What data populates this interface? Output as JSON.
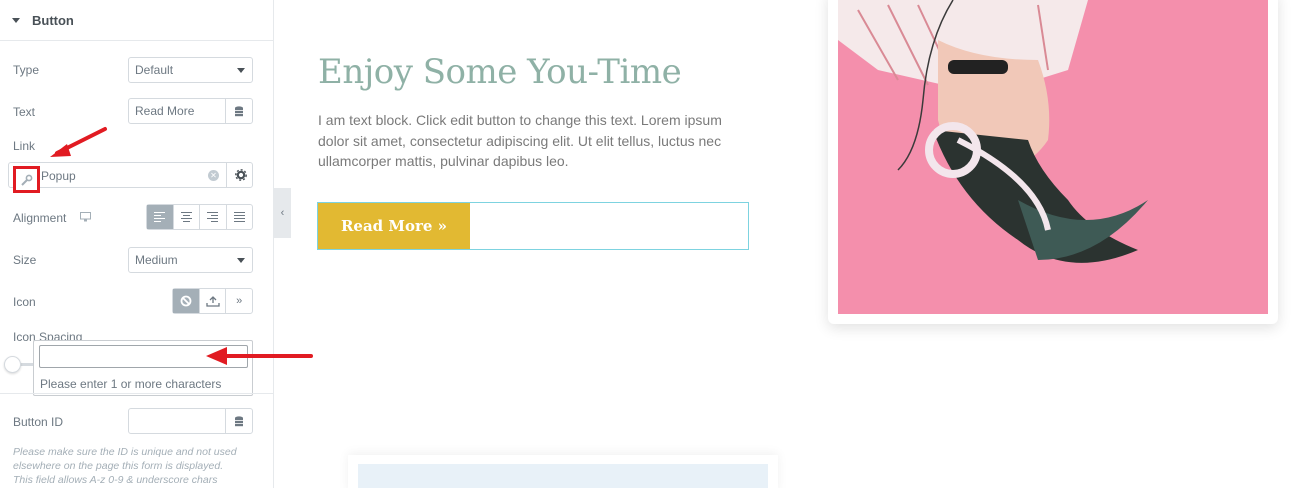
{
  "panel": {
    "section_title": "Button",
    "type_label": "Type",
    "type_value": "Default",
    "text_label": "Text",
    "text_value": "Read More",
    "link_label": "Link",
    "link_value": "Popup",
    "alignment_label": "Alignment",
    "size_label": "Size",
    "size_value": "Medium",
    "icon_label": "Icon",
    "icon_spacing_label": "Icon Spacing",
    "dropdown_message": "Please enter 1 or more characters",
    "button_id_label": "Button ID",
    "note_line1": "Please make sure the ID is unique and not used",
    "note_line2": "elsewhere on the page this form is displayed.",
    "note_line3": "This field allows A-z  0-9 & underscore chars"
  },
  "canvas": {
    "heading": "Enjoy Some You-Time",
    "body": "I am text block. Click edit button to change this text. Lorem ipsum dolor sit amet, consectetur adipiscing elit. Ut elit tellus, luctus nec ullamcorper mattis, pulvinar dapibus leo.",
    "button_label": "Read More »"
  },
  "colors": {
    "heading": "#8fb1a6",
    "button": "#e2b932",
    "arrow": "#e11b22",
    "photo_bg": "#f48fac"
  }
}
